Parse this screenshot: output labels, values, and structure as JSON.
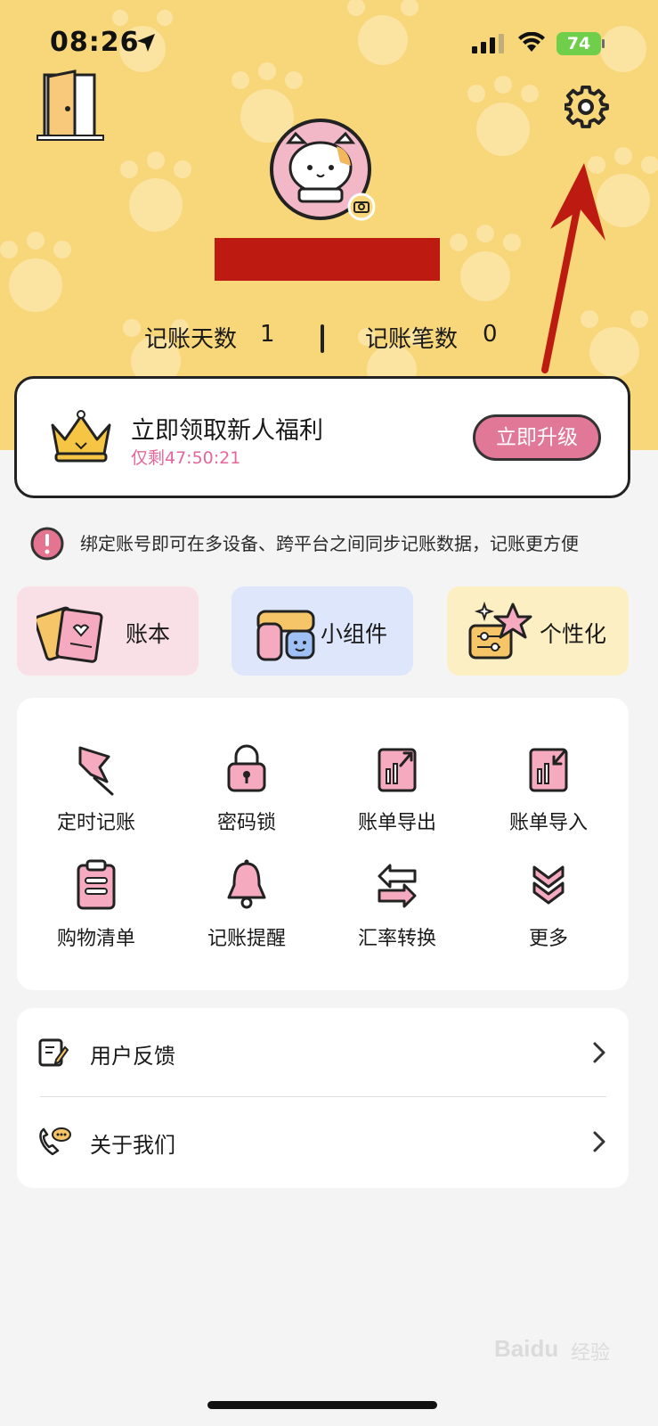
{
  "status_bar": {
    "time": "08:26",
    "battery": "74"
  },
  "profile": {
    "stats": [
      {
        "label": "记账天数",
        "value": "1"
      },
      {
        "label": "记账笔数",
        "value": "0"
      }
    ]
  },
  "promo": {
    "title": "立即领取新人福利",
    "timer": "仅剩47:50:21",
    "button": "立即升级"
  },
  "notice": {
    "text": "绑定账号即可在多设备、跨平台之间同步记账数据，记账更方便"
  },
  "features": [
    {
      "label": "账本",
      "bg": "#f9dfe6"
    },
    {
      "label": "小组件",
      "bg": "#dde6fb"
    },
    {
      "label": "个性化",
      "bg": "#fcefc4"
    }
  ],
  "tools": [
    {
      "label": "定时记账",
      "icon": "pushpin-icon"
    },
    {
      "label": "密码锁",
      "icon": "padlock-icon"
    },
    {
      "label": "账单导出",
      "icon": "bill-export-icon"
    },
    {
      "label": "账单导入",
      "icon": "bill-import-icon"
    },
    {
      "label": "购物清单",
      "icon": "clipboard-icon"
    },
    {
      "label": "记账提醒",
      "icon": "bell-icon"
    },
    {
      "label": "汇率转换",
      "icon": "exchange-arrows-icon"
    },
    {
      "label": "更多",
      "icon": "double-chevron-down-icon"
    }
  ],
  "menu": [
    {
      "label": "用户反馈",
      "icon": "feedback-edit-icon"
    },
    {
      "label": "关于我们",
      "icon": "phone-chat-icon"
    }
  ],
  "watermark": {
    "brand": "Baidu",
    "suffix": "经验"
  },
  "colors": {
    "header_bg": "#f8d77b",
    "accent_pink": "#e27898",
    "timer_pink": "#e3679a",
    "annotation_red": "#bd1b12"
  }
}
